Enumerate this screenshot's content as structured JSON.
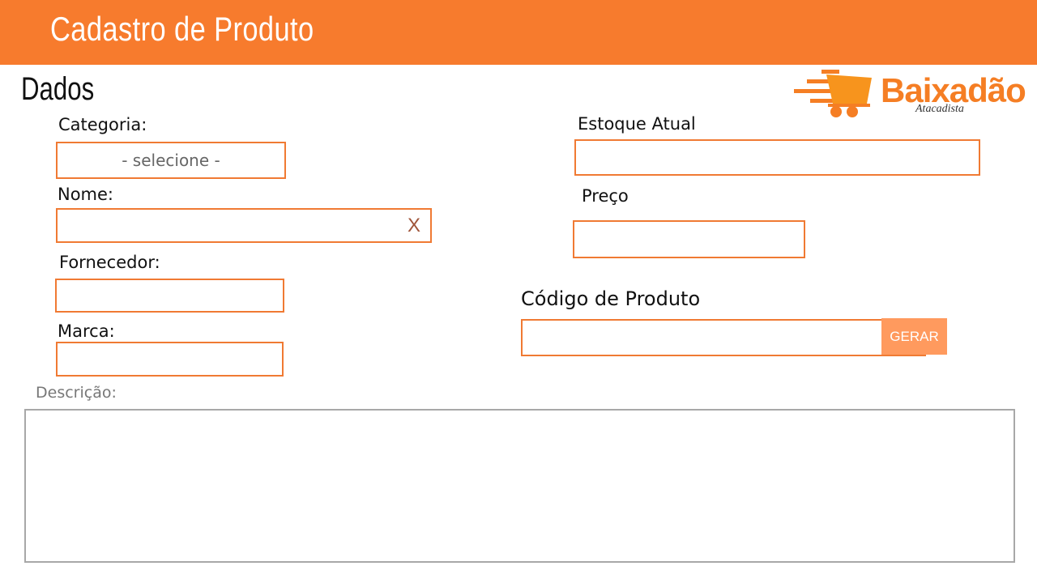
{
  "header": {
    "title": "Cadastro de Produto"
  },
  "section": {
    "title": "Dados"
  },
  "logo": {
    "name": "Baixadão",
    "subtitle": "Atacadista",
    "icon": "shopping-cart-icon",
    "color": "#f57e24"
  },
  "form": {
    "categoria": {
      "label": "Categoria:",
      "selected": "-  selecione -"
    },
    "nome": {
      "label": "Nome:",
      "value": "",
      "clear_label": "X"
    },
    "fornecedor": {
      "label": "Fornecedor:",
      "value": ""
    },
    "marca": {
      "label": "Marca:",
      "value": ""
    },
    "estoque": {
      "label": "Estoque Atual",
      "value": ""
    },
    "preco": {
      "label": "Preço",
      "value": ""
    },
    "codigo": {
      "label": "Código de Produto",
      "value": "",
      "button_label": "GERAR"
    },
    "descricao": {
      "label": "Descrição:",
      "value": ""
    }
  },
  "colors": {
    "header": "#f77b2d",
    "field_border": "#f07a33",
    "button": "#ff9a5e"
  }
}
